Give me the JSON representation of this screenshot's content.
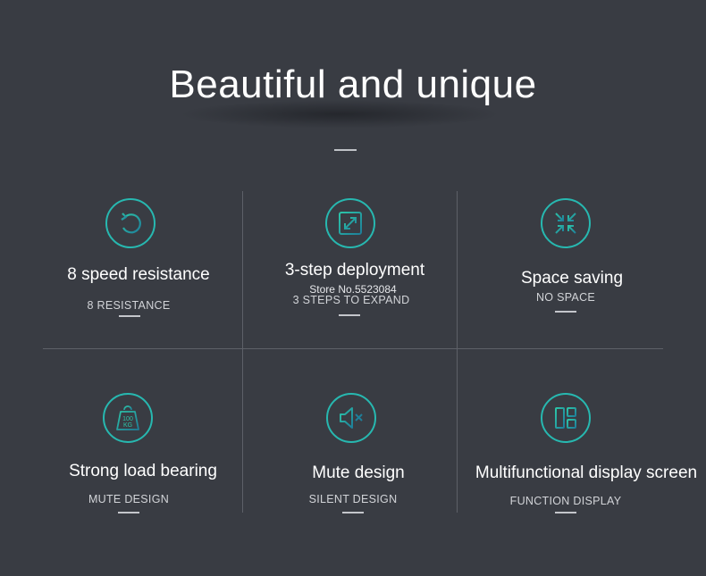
{
  "header": {
    "title": "Beautiful and unique"
  },
  "store_watermark": "Store No.5523084",
  "features": [
    {
      "title": "8 speed resistance",
      "subtitle": "8 RESISTANCE",
      "icon": "rotate-arrow-icon"
    },
    {
      "title": "3-step deployment",
      "subtitle": "3 STEPS TO EXPAND",
      "icon": "expand-arrows-icon"
    },
    {
      "title": "Space saving",
      "subtitle": "NO SPACE",
      "icon": "compress-arrows-icon"
    },
    {
      "title": "Strong load bearing",
      "subtitle": "MUTE DESIGN",
      "icon": "weight-100kg-icon",
      "icon_text": "100 KG"
    },
    {
      "title": "Mute design",
      "subtitle": "SILENT DESIGN",
      "icon": "speaker-mute-icon"
    },
    {
      "title": "Multifunctional display screen",
      "subtitle": "FUNCTION DISPLAY",
      "icon": "layout-grid-icon"
    }
  ],
  "colors": {
    "background": "#393c43",
    "accent": "#27b8b0",
    "accent_alt": "#1e7f9a"
  }
}
